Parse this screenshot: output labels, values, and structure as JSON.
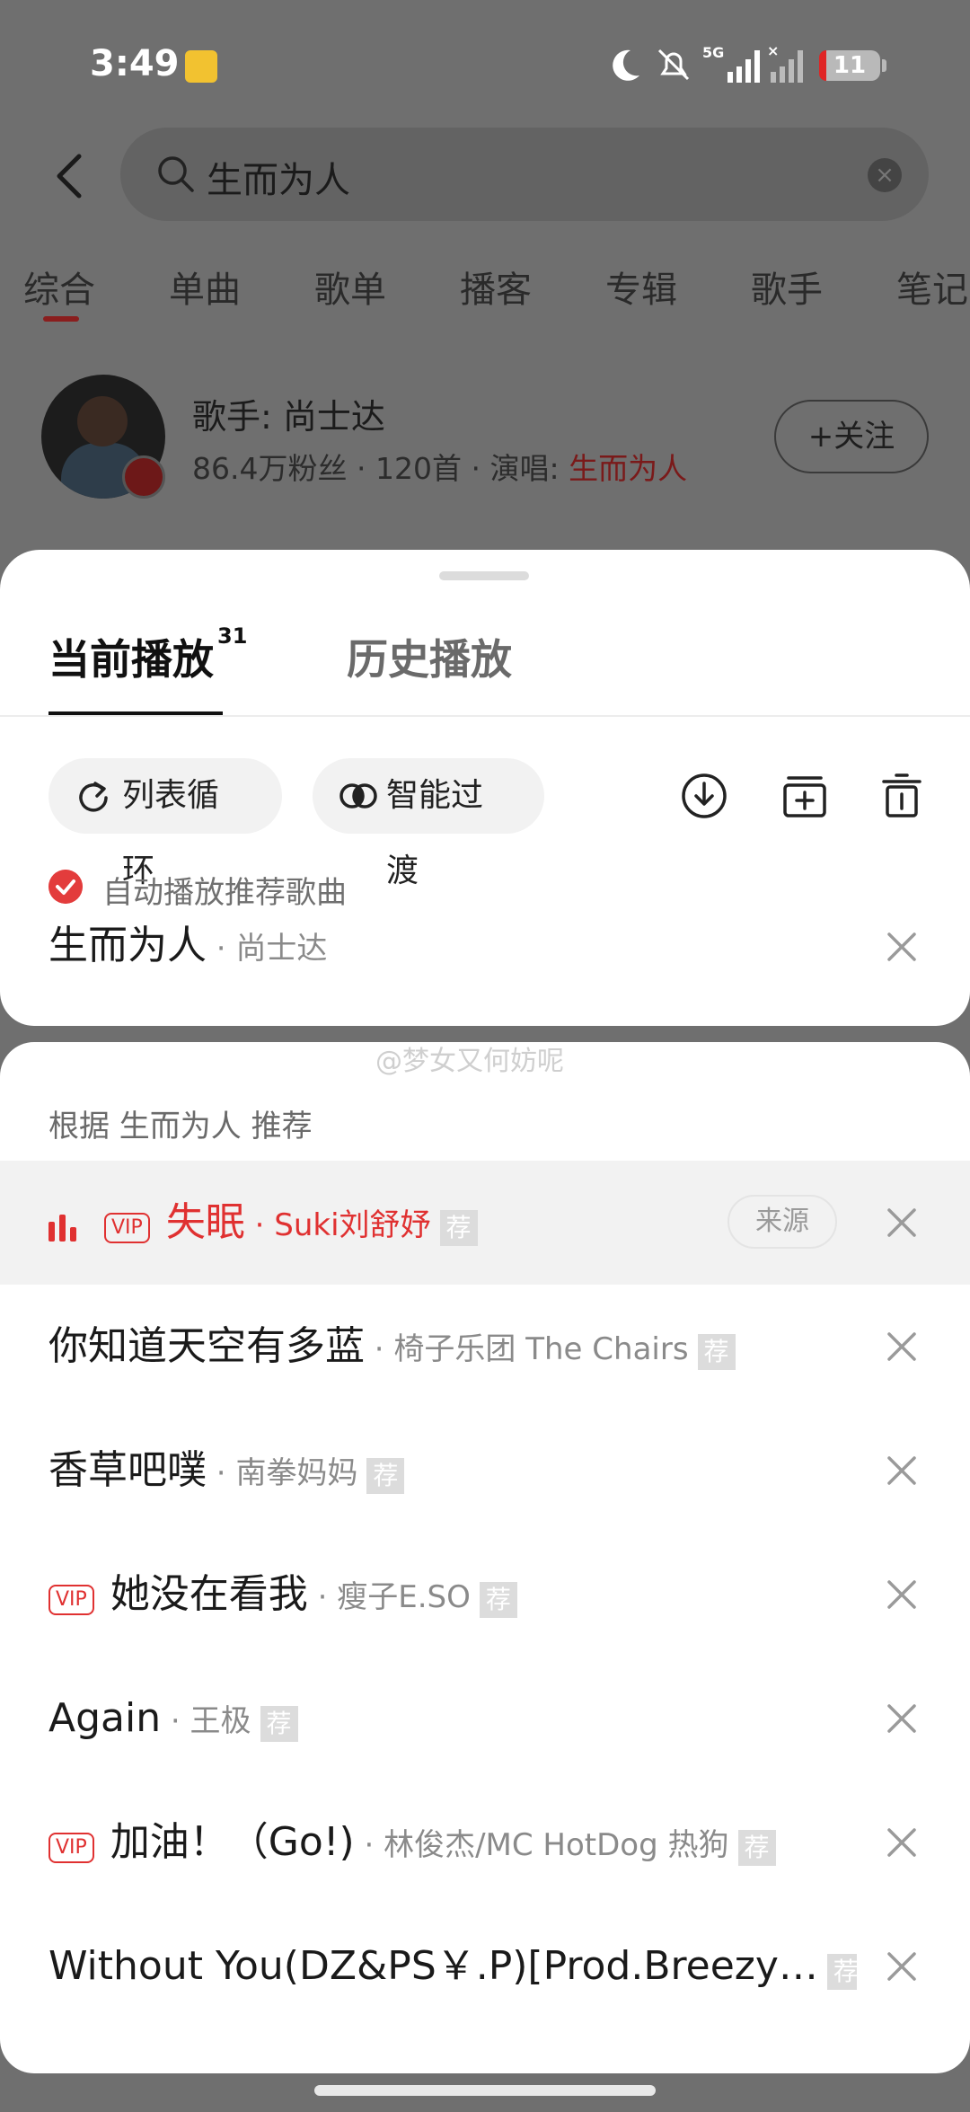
{
  "status_bar": {
    "time": "3:49",
    "battery": "11",
    "network": "5G"
  },
  "search": {
    "query": "生而为人"
  },
  "search_tabs": [
    "综合",
    "单曲",
    "歌单",
    "播客",
    "专辑",
    "歌手",
    "笔记"
  ],
  "artist": {
    "name": "歌手: 尚士达",
    "fans": "86.4万粉丝",
    "songs": "120首",
    "sung_label": "演唱:",
    "sung_song": "生而为人",
    "follow_label": "+关注"
  },
  "sheet": {
    "tab_current": "当前播放",
    "tab_current_count": "31",
    "tab_history": "历史播放",
    "loop_label": "列表循环",
    "transition_label": "智能过渡",
    "auto_play_label": "自动播放推荐歌曲",
    "current_song": {
      "title": "生而为人",
      "artist": "尚士达"
    }
  },
  "watermark": "@梦女又何妨呢",
  "recommend": {
    "heading": "根据 生而为人 推荐",
    "source_label": "来源",
    "tag_label": "荐",
    "vip_label": "VIP",
    "items": [
      {
        "title": "失眠",
        "artist": "Suki刘舒妤"
      },
      {
        "title": "你知道天空有多蓝",
        "artist": "椅子乐团 The Chairs"
      },
      {
        "title": "香草吧噗",
        "artist": "南拳妈妈"
      },
      {
        "title": "她没在看我",
        "artist": "瘦子E.SO"
      },
      {
        "title": "Again",
        "artist": "王极"
      },
      {
        "title": "加油！（Go!)",
        "artist": "林俊杰/MC HotDog 热狗"
      },
      {
        "title": "Without You(DZ&PS￥.P)[Prod.Breezy…",
        "artist": ""
      }
    ]
  },
  "colors": {
    "accent": "#e03131",
    "overlay": "#6f6f6f",
    "sheet": "#ffffff"
  }
}
